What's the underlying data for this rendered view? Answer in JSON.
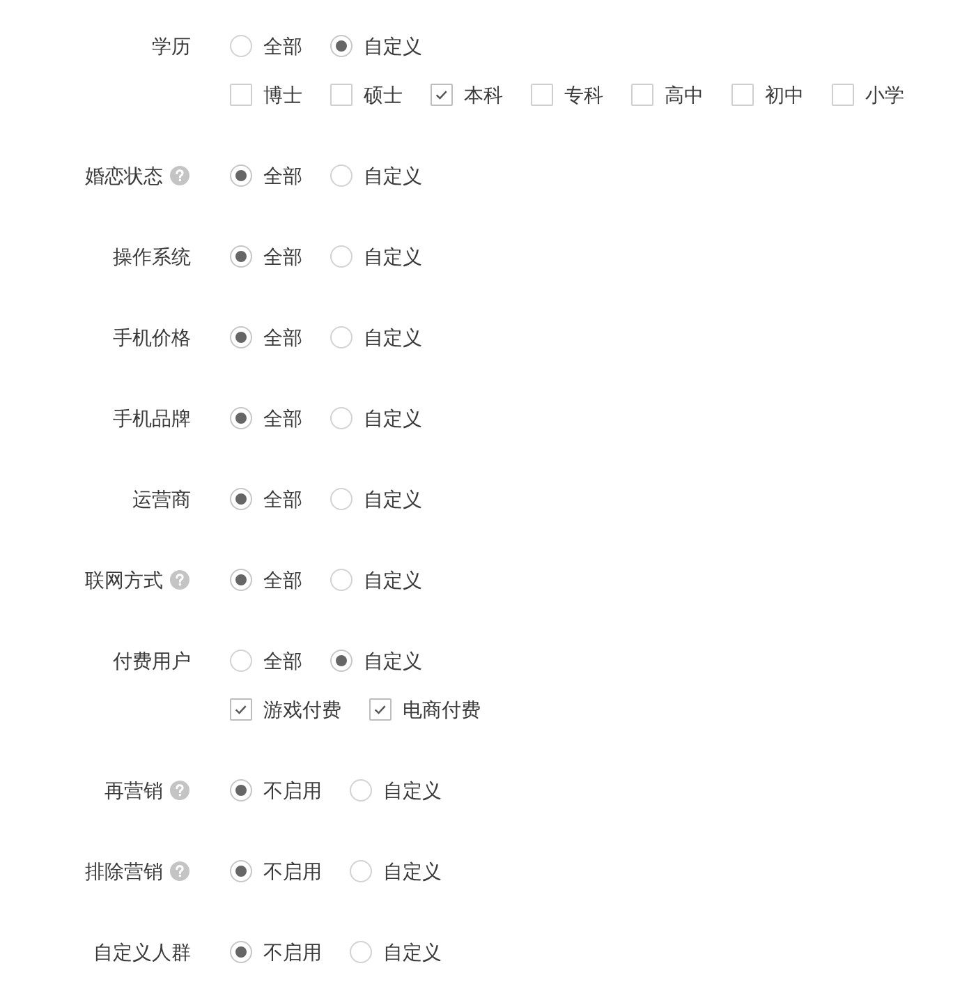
{
  "fields": [
    {
      "label": "学历",
      "help": false,
      "options": [
        {
          "label": "全部",
          "selected": false
        },
        {
          "label": "自定义",
          "selected": true
        }
      ],
      "choices": [
        {
          "label": "博士",
          "checked": false
        },
        {
          "label": "硕士",
          "checked": false
        },
        {
          "label": "本科",
          "checked": true
        },
        {
          "label": "专科",
          "checked": false
        },
        {
          "label": "高中",
          "checked": false
        },
        {
          "label": "初中",
          "checked": false
        },
        {
          "label": "小学",
          "checked": false
        }
      ]
    },
    {
      "label": "婚恋状态",
      "help": true,
      "options": [
        {
          "label": "全部",
          "selected": true
        },
        {
          "label": "自定义",
          "selected": false
        }
      ]
    },
    {
      "label": "操作系统",
      "help": false,
      "options": [
        {
          "label": "全部",
          "selected": true
        },
        {
          "label": "自定义",
          "selected": false
        }
      ]
    },
    {
      "label": "手机价格",
      "help": false,
      "options": [
        {
          "label": "全部",
          "selected": true
        },
        {
          "label": "自定义",
          "selected": false
        }
      ]
    },
    {
      "label": "手机品牌",
      "help": false,
      "options": [
        {
          "label": "全部",
          "selected": true
        },
        {
          "label": "自定义",
          "selected": false
        }
      ]
    },
    {
      "label": "运营商",
      "help": false,
      "options": [
        {
          "label": "全部",
          "selected": true
        },
        {
          "label": "自定义",
          "selected": false
        }
      ]
    },
    {
      "label": "联网方式",
      "help": true,
      "options": [
        {
          "label": "全部",
          "selected": true
        },
        {
          "label": "自定义",
          "selected": false
        }
      ]
    },
    {
      "label": "付费用户",
      "help": false,
      "options": [
        {
          "label": "全部",
          "selected": false
        },
        {
          "label": "自定义",
          "selected": true
        }
      ],
      "choices": [
        {
          "label": "游戏付费",
          "checked": true
        },
        {
          "label": "电商付费",
          "checked": true
        }
      ]
    },
    {
      "label": "再营销",
      "help": true,
      "options": [
        {
          "label": "不启用",
          "selected": true
        },
        {
          "label": "自定义",
          "selected": false
        }
      ]
    },
    {
      "label": "排除营销",
      "help": true,
      "options": [
        {
          "label": "不启用",
          "selected": true
        },
        {
          "label": "自定义",
          "selected": false
        }
      ]
    },
    {
      "label": "自定义人群",
      "help": false,
      "options": [
        {
          "label": "不启用",
          "selected": true
        },
        {
          "label": "自定义",
          "selected": false
        }
      ]
    }
  ]
}
